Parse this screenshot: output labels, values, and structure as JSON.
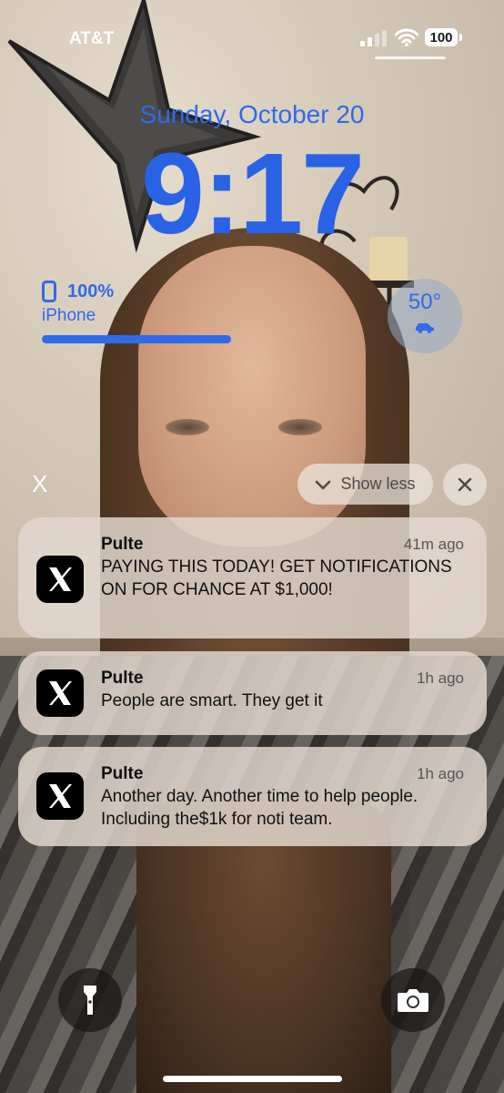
{
  "status_bar": {
    "carrier": "AT&T",
    "battery_level": "100"
  },
  "lock_screen": {
    "date": "Sunday, October 20",
    "time": "9:17"
  },
  "widgets": {
    "battery": {
      "percent_label": "100%",
      "device": "iPhone",
      "level": 1.0
    },
    "weather": {
      "temperature": "50°",
      "icon": "car-icon"
    }
  },
  "notification_controls": {
    "close_glyph": "X",
    "show_less_label": "Show less"
  },
  "notifications": [
    {
      "app_icon": "x-app-icon",
      "title": "Pulte",
      "time_ago": "41m ago",
      "body": "PAYING THIS TODAY! GET NOTIFICATIONS ON FOR CHANCE AT $1,000!"
    },
    {
      "app_icon": "x-app-icon",
      "title": "Pulte",
      "time_ago": "1h ago",
      "body": "People are smart. They get it"
    },
    {
      "app_icon": "x-app-icon",
      "title": "Pulte",
      "time_ago": "1h ago",
      "body": "Another day. Another time to help people. Including the$1k for noti team."
    }
  ],
  "bottom_controls": {
    "left": "flashlight-icon",
    "right": "camera-icon"
  },
  "colors": {
    "clock_blue": "#2a62e6",
    "notification_bg": "#e2d8ce"
  }
}
